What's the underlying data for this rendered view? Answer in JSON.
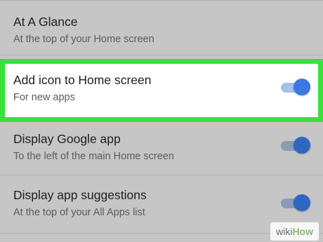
{
  "settings": {
    "items": [
      {
        "title": "At A Glance",
        "subtitle": "At the top of your Home screen"
      },
      {
        "title": "Add icon to Home screen",
        "subtitle": "For new apps",
        "toggle": "on",
        "highlighted": true
      },
      {
        "title": "Display Google app",
        "subtitle": "To the left of the main Home screen",
        "toggle": "on"
      },
      {
        "title": "Display app suggestions",
        "subtitle": "At the top of your All Apps list",
        "toggle": "on"
      }
    ]
  },
  "colors": {
    "highlight_border": "#3ce03c",
    "toggle_accent": "#3b78e0",
    "background": "#c6c6c6"
  },
  "watermark": {
    "part1": "wiki",
    "part2": "How"
  }
}
